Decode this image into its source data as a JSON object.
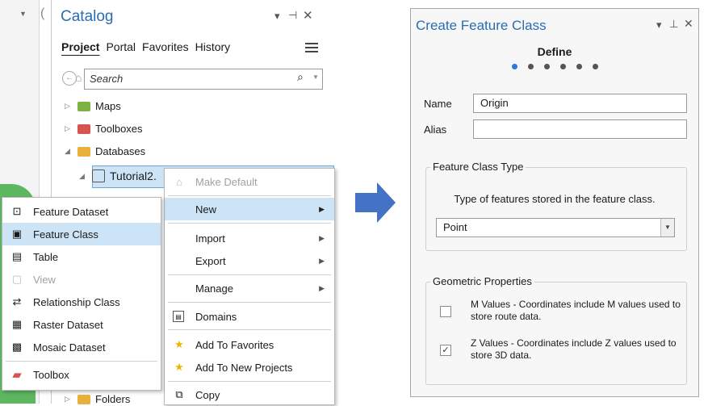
{
  "catalog": {
    "title": "Catalog",
    "tabs": [
      "Project",
      "Portal",
      "Favorites",
      "History"
    ],
    "search_placeholder": "Search",
    "tree": [
      {
        "label": "Maps"
      },
      {
        "label": "Toolboxes"
      },
      {
        "label": "Databases"
      },
      {
        "label": "Tutorial2."
      },
      {
        "label": "Folders"
      }
    ]
  },
  "context_menu": {
    "items": {
      "make_default": "Make Default",
      "new": "New",
      "import": "Import",
      "export": "Export",
      "manage": "Manage",
      "domains": "Domains",
      "add_favorites": "Add To Favorites",
      "add_new_projects": "Add To New Projects",
      "copy": "Copy"
    }
  },
  "new_submenu": {
    "items": {
      "feature_dataset": "Feature Dataset",
      "feature_class": "Feature Class",
      "table": "Table",
      "view": "View",
      "relationship_class": "Relationship Class",
      "raster_dataset": "Raster Dataset",
      "mosaic_dataset": "Mosaic Dataset",
      "toolbox": "Toolbox"
    }
  },
  "create_feature_class": {
    "title": "Create Feature Class",
    "step_title": "Define",
    "steps_total": 6,
    "current_step": 1,
    "name_label": "Name",
    "name_value": "Origin",
    "alias_label": "Alias",
    "alias_value": "",
    "type_group_title": "Feature Class Type",
    "type_description": "Type of features stored in the feature class.",
    "type_value": "Point",
    "geom_group_title": "Geometric Properties",
    "m_values_label": "M Values - Coordinates include M values used to store route data.",
    "m_values_checked": false,
    "z_values_label": "Z Values - Coordinates include Z values used to store 3D data.",
    "z_values_checked": true
  },
  "colors": {
    "accent": "#2b6cb0",
    "highlight": "#cde4f7",
    "arrow": "#4472c4",
    "star": "#f0b400"
  }
}
